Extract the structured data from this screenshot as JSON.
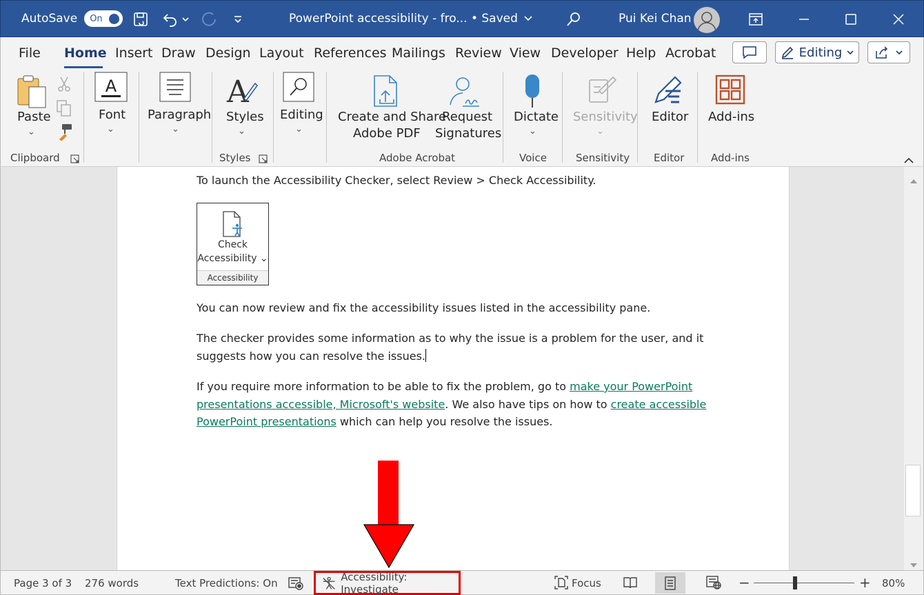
{
  "titlebar": {
    "autosave_label": "AutoSave",
    "autosave_state": "On",
    "doc_title": "PowerPoint accessibility - fro...  • Saved",
    "user_name": "Pui Kei Chan"
  },
  "menu": {
    "tabs": [
      "File",
      "Home",
      "Insert",
      "Draw",
      "Design",
      "Layout",
      "References",
      "Mailings",
      "Review",
      "View",
      "Developer",
      "Help",
      "Acrobat"
    ],
    "active": "Home",
    "editing_label": "Editing"
  },
  "ribbon": {
    "paste": "Paste",
    "clipboard": "Clipboard",
    "font": "Font",
    "paragraph": "Paragraph",
    "styles": "Styles",
    "styles_group": "Styles",
    "editing": "Editing",
    "create_share_1": "Create and Share",
    "create_share_2": "Adobe PDF",
    "request_1": "Request",
    "request_2": "Signatures",
    "adobe_group": "Adobe Acrobat",
    "dictate": "Dictate",
    "voice_group": "Voice",
    "sensitivity": "Sensitivity",
    "sensitivity_group": "Sensitivity",
    "editor": "Editor",
    "editor_group": "Editor",
    "addins": "Add-ins",
    "addins_group": "Add-ins"
  },
  "document": {
    "p1": "To launch the Accessibility Checker, select Review > Check Accessibility.",
    "check_line1": "Check",
    "check_line2": "Accessibility",
    "check_group": "Accessibility",
    "p2": "You can now review and fix the accessibility issues listed in the accessibility pane.",
    "p3": "The checker provides some information as to why the issue is a problem for the user, and it suggests how you can resolve the issues.",
    "p4_a": "If you require more information to be able to fix the problem, go to ",
    "p4_link1": "make your PowerPoint presentations accessible, Microsoft's website",
    "p4_b": ". We also have tips on how to ",
    "p4_link2": "create accessible PowerPoint presentations",
    "p4_c": " which can help you resolve the issues."
  },
  "status": {
    "page": "Page 3 of 3",
    "words": "276 words",
    "predictions": "Text Predictions: On",
    "accessibility": "Accessibility: Investigate",
    "focus": "Focus",
    "zoom": "80%",
    "zoom_level_percent": 80
  },
  "colors": {
    "title_blue": "#2b579a",
    "highlight_red": "#ff0000",
    "link_green": "#0b7a5e"
  }
}
